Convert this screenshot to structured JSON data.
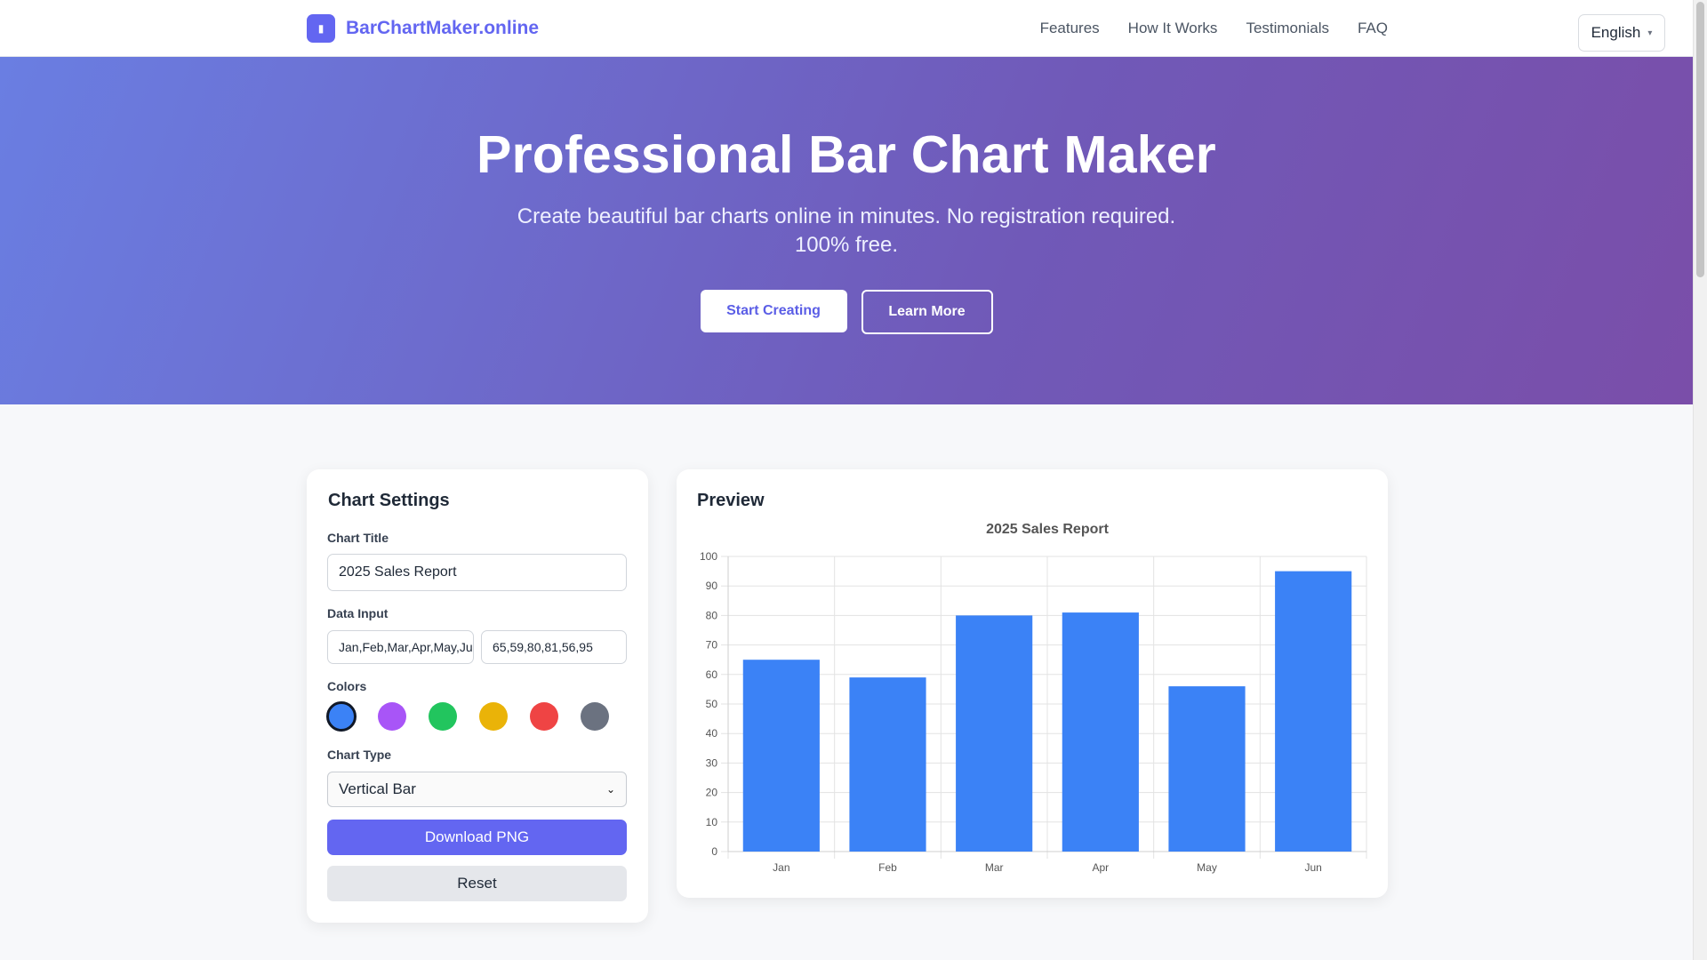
{
  "nav": {
    "logo_icon": "chart-icon",
    "brand": "BarChartMaker.online",
    "links": [
      "Features",
      "How It Works",
      "Testimonials",
      "FAQ"
    ],
    "language": "English"
  },
  "hero": {
    "title": "Professional Bar Chart Maker",
    "subtitle": "Create beautiful bar charts online in minutes. No registration required. 100% free.",
    "primary_button": "Start Creating",
    "secondary_button": "Learn More"
  },
  "settings": {
    "heading": "Chart Settings",
    "title_label": "Chart Title",
    "title_value": "2025 Sales Report",
    "data_label": "Data Input",
    "labels_value": "Jan,Feb,Mar,Apr,May,Jun",
    "values_value": "65,59,80,81,56,95",
    "colors_label": "Colors",
    "colors": [
      "#3b82f6",
      "#a855f7",
      "#22c55e",
      "#eab308",
      "#ef4444",
      "#6b7280"
    ],
    "selected_color": "#3b82f6",
    "type_label": "Chart Type",
    "type_value": "Vertical Bar",
    "download_button": "Download PNG",
    "reset_button": "Reset"
  },
  "preview": {
    "heading": "Preview"
  },
  "chart_data": {
    "type": "bar",
    "title": "2025 Sales Report",
    "categories": [
      "Jan",
      "Feb",
      "Mar",
      "Apr",
      "May",
      "Jun"
    ],
    "values": [
      65,
      59,
      80,
      81,
      56,
      95
    ],
    "ylim": [
      0,
      100
    ],
    "yticks": [
      0,
      10,
      20,
      30,
      40,
      50,
      60,
      70,
      80,
      90,
      100
    ],
    "color": "#3b82f6",
    "grid": true,
    "xlabel": "",
    "ylabel": ""
  }
}
